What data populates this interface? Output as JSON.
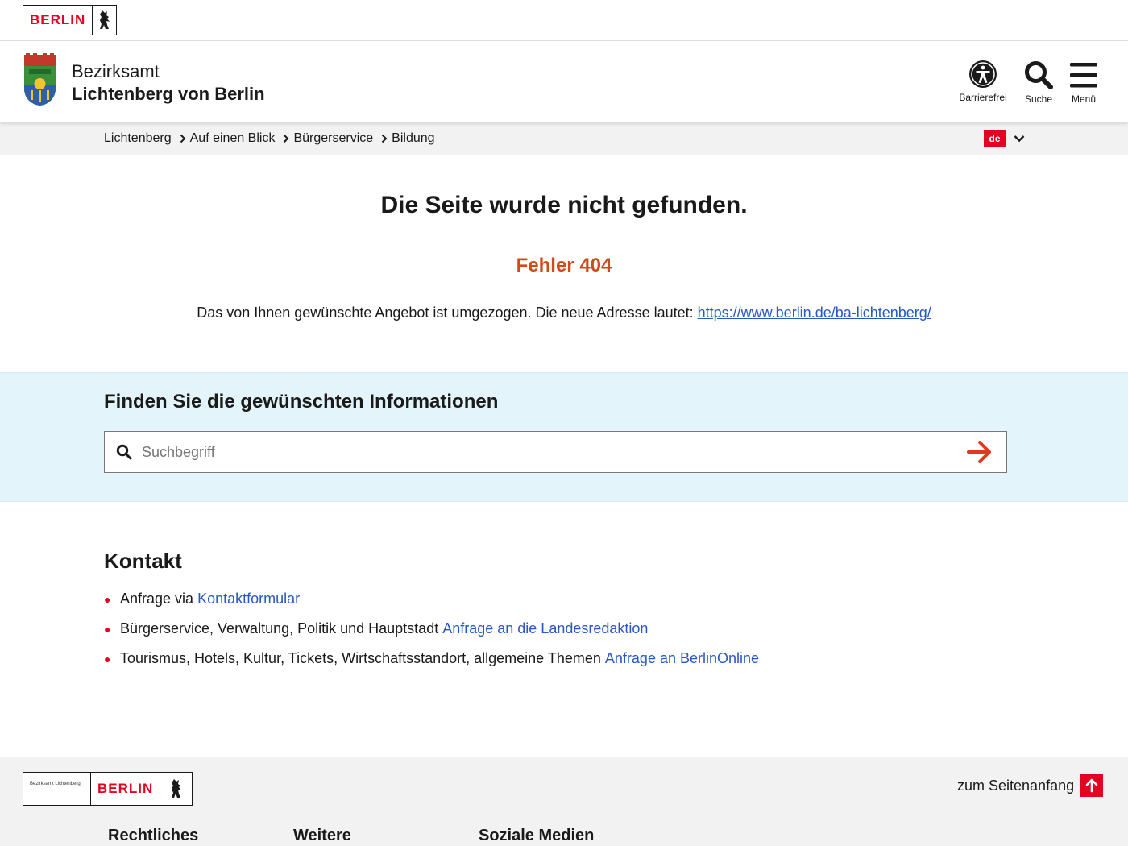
{
  "topbar": {
    "logo_text": "BERLIN"
  },
  "header": {
    "org_line1": "Bezirksamt",
    "org_line2": "Lichtenberg von Berlin",
    "buttons": {
      "accessibility": "Barrierefrei",
      "search": "Suche",
      "menu": "Menü"
    }
  },
  "breadcrumb": {
    "items": [
      "Lichtenberg",
      "Auf einen Blick",
      "Bürgerservice",
      "Bildung"
    ]
  },
  "language": {
    "current": "de"
  },
  "error": {
    "title": "Die Seite wurde nicht gefunden.",
    "code": "Fehler 404",
    "text": "Das von Ihnen gewünschte Angebot ist umgezogen. Die neue Adresse lautet:",
    "link": "https://www.berlin.de/ba-lichtenberg/"
  },
  "search": {
    "heading": "Finden Sie die gewünschten Informationen",
    "placeholder": "Suchbegriff"
  },
  "kontakt": {
    "heading": "Kontakt",
    "items": [
      {
        "text": "Anfrage via",
        "link": "Kontaktformular"
      },
      {
        "text": "Bürgerservice, Verwaltung, Politik und Hauptstadt",
        "link": "Anfrage an die Landesredaktion"
      },
      {
        "text": "Tourismus, Hotels, Kultur, Tickets, Wirtschaftsstandort, allgemeine Themen",
        "link": "Anfrage an BerlinOnline"
      }
    ]
  },
  "footer": {
    "logo_small_text": "Bezirksamt Lichtenberg",
    "logo_text": "BERLIN",
    "to_top": "zum Seitenanfang",
    "headings": [
      "Rechtliches",
      "Weitere",
      "Soziale Medien"
    ]
  },
  "colors": {
    "brand_red": "#e40422",
    "error_orange": "#d24a1c",
    "link_blue": "#2957c4",
    "search_bg": "#e3f5fa"
  }
}
